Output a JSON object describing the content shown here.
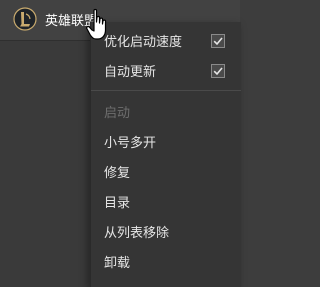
{
  "app": {
    "name": "英雄联盟",
    "logo_icon": "league-of-legends-logo-icon"
  },
  "menu": {
    "items": [
      {
        "label": "优化启动速度",
        "checked": true,
        "disabled": false
      },
      {
        "label": "自动更新",
        "checked": true,
        "disabled": false
      },
      {
        "label": "启动",
        "checked": null,
        "disabled": true
      },
      {
        "label": "小号多开",
        "checked": null,
        "disabled": false
      },
      {
        "label": "修复",
        "checked": null,
        "disabled": false
      },
      {
        "label": "目录",
        "checked": null,
        "disabled": false
      },
      {
        "label": "从列表移除",
        "checked": null,
        "disabled": false
      },
      {
        "label": "卸载",
        "checked": null,
        "disabled": false
      }
    ]
  },
  "colors": {
    "background": "#3d3d3d",
    "menu_bg": "#353535",
    "text": "#e6e6e6",
    "disabled_text": "#6e6e6e",
    "logo_gold": "#c8aa6e"
  },
  "cursor_icon": "hand-pointer-icon"
}
